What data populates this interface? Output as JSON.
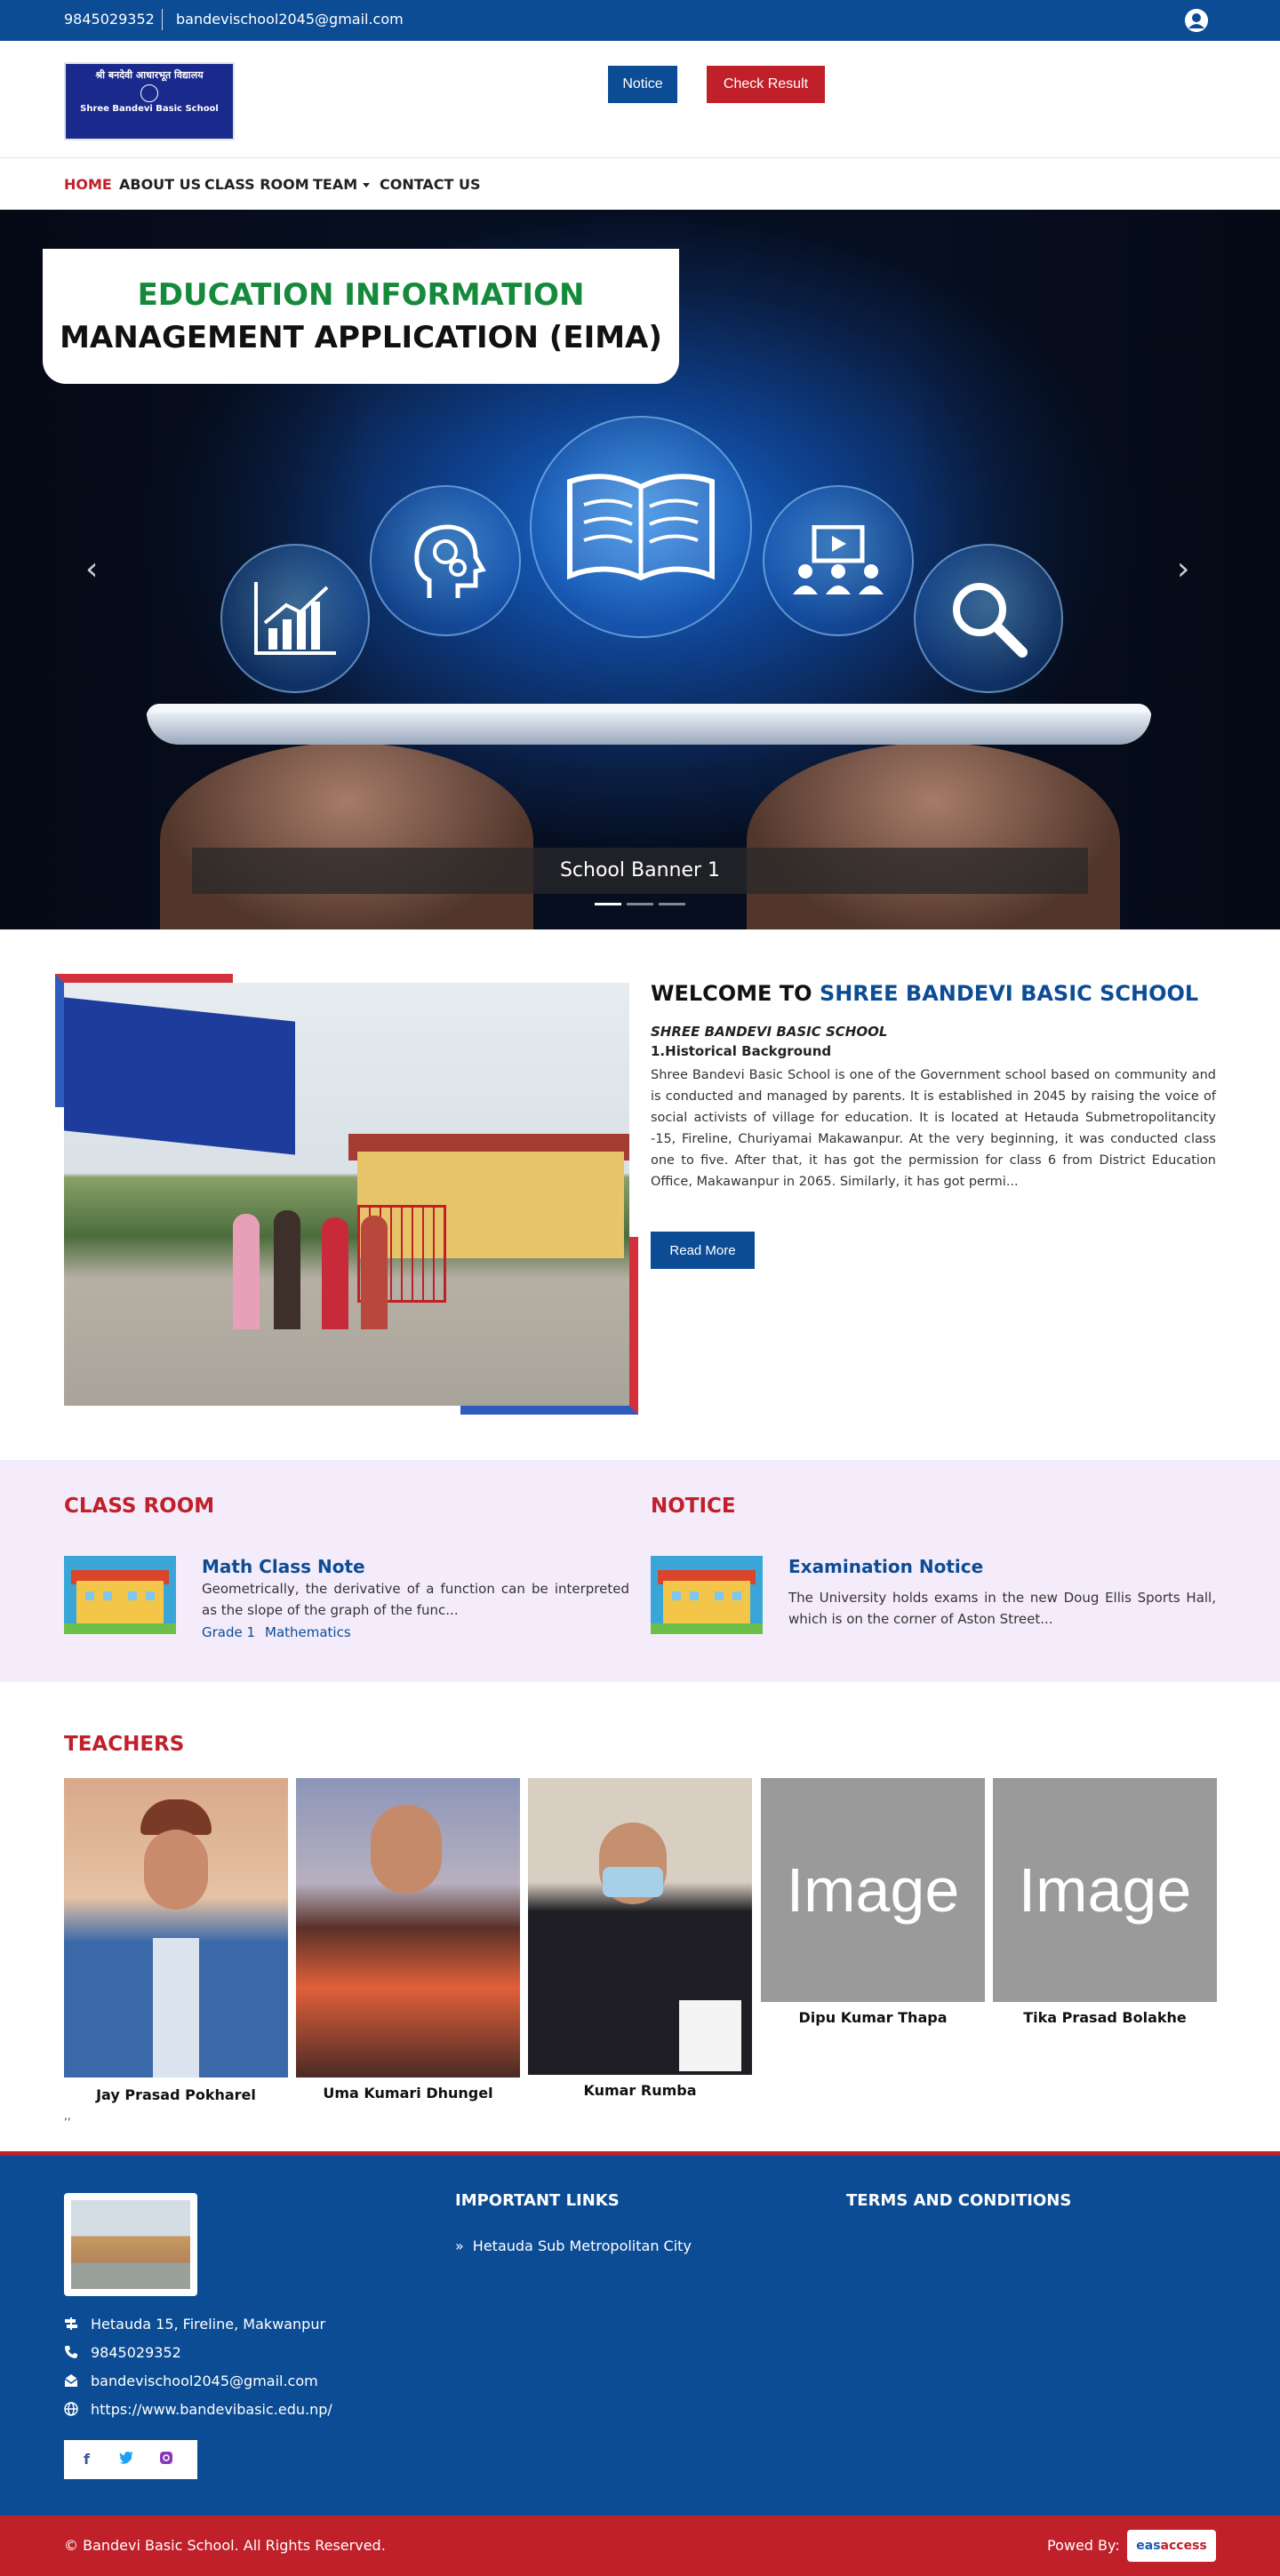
{
  "topbar": {
    "phone": "9845029352",
    "email": "bandevischool2045@gmail.com",
    "user_icon": "user-circle-icon"
  },
  "header": {
    "logo_line1": "श्री बनदेवी आधारभूत विद्यालय",
    "logo_line2": "Shree Bandevi Basic School",
    "notice_button": "Notice",
    "result_button": "Check Result"
  },
  "nav": {
    "items": [
      {
        "label": "HOME",
        "active": true
      },
      {
        "label": "ABOUT US",
        "active": false
      },
      {
        "label": "CLASS ROOM",
        "active": false
      },
      {
        "label": "TEAM",
        "active": false
      },
      {
        "label": "CONTACT US",
        "active": false
      }
    ]
  },
  "hero": {
    "title_line1": "EDUCATION INFORMATION",
    "title_line2": "MANAGEMENT APPLICATION (EIMA)",
    "caption": "School Banner 1",
    "prev_icon": "chevron-left-icon",
    "next_icon": "chevron-right-icon",
    "slide_count": 3,
    "active_slide": 1
  },
  "welcome": {
    "title_prefix": "WELCOME TO ",
    "title_school": "SHREE BANDEVI BASIC SCHOOL",
    "subtitle": "SHREE BANDEVI BASIC SCHOOL",
    "heading": "1.Historical Background",
    "body": "Shree Bandevi Basic School is one of the Government school based on community and is conducted and managed by parents. It is established in 2045 by raising the voice of social activists of village for education. It is located at Hetauda Submetropolitancity -15, Fireline, Churiyamai Makawanpur. At the very beginning, it was conducted class one to five. After that, it has got the permission for class 6 from District Education Office, Makawanpur in 2065. Similarly, it has got permi...",
    "read_more": "Read More"
  },
  "classroom": {
    "title": "CLASS ROOM",
    "item_title": "Math Class Note",
    "item_body": "Geometrically, the derivative of a function can be interpreted as the slope of the graph of the func...",
    "tag1": "Grade 1",
    "tag2": "Mathematics"
  },
  "notice": {
    "title": "NOTICE",
    "item_title": "Examination Notice",
    "item_body": "The University holds exams in the new Doug Ellis Sports Hall, which is on the corner of Aston Street..."
  },
  "teachers": {
    "title": "TEACHERS",
    "list": [
      {
        "name": "Jay Prasad Pokharel"
      },
      {
        "name": "Uma Kumari Dhungel"
      },
      {
        "name": "Kumar Rumba"
      },
      {
        "name": "Dipu Kumar Thapa",
        "placeholder": "Image"
      },
      {
        "name": "Tika Prasad Bolakhe",
        "placeholder": "Image"
      }
    ],
    "stray": "‚‚"
  },
  "footer": {
    "address": "Hetauda 15, Fireline, Makwanpur",
    "phone": "9845029352",
    "email": "bandevischool2045@gmail.com",
    "website": "https://www.bandevibasic.edu.np/",
    "links_title": "IMPORTANT LINKS",
    "link1": "Hetauda Sub Metropolitan City",
    "terms_title": "TERMS AND CONDITIONS",
    "social": [
      "facebook-icon",
      "twitter-icon",
      "instagram-icon"
    ],
    "facebook_color": "#3b5998",
    "twitter_color": "#1da1f2",
    "instagram_color": "#8a3ab9"
  },
  "bottom": {
    "copyright": "© Bandevi Basic School. All Rights Reserved.",
    "powered_by": "Powed By:",
    "brand_part1": "eas",
    "brand_part2": "access"
  },
  "colors": {
    "primary_blue": "#0c4c95",
    "accent_red": "#c0202a",
    "hero_green": "#168a3c",
    "lavender": "#f4ecfb"
  }
}
